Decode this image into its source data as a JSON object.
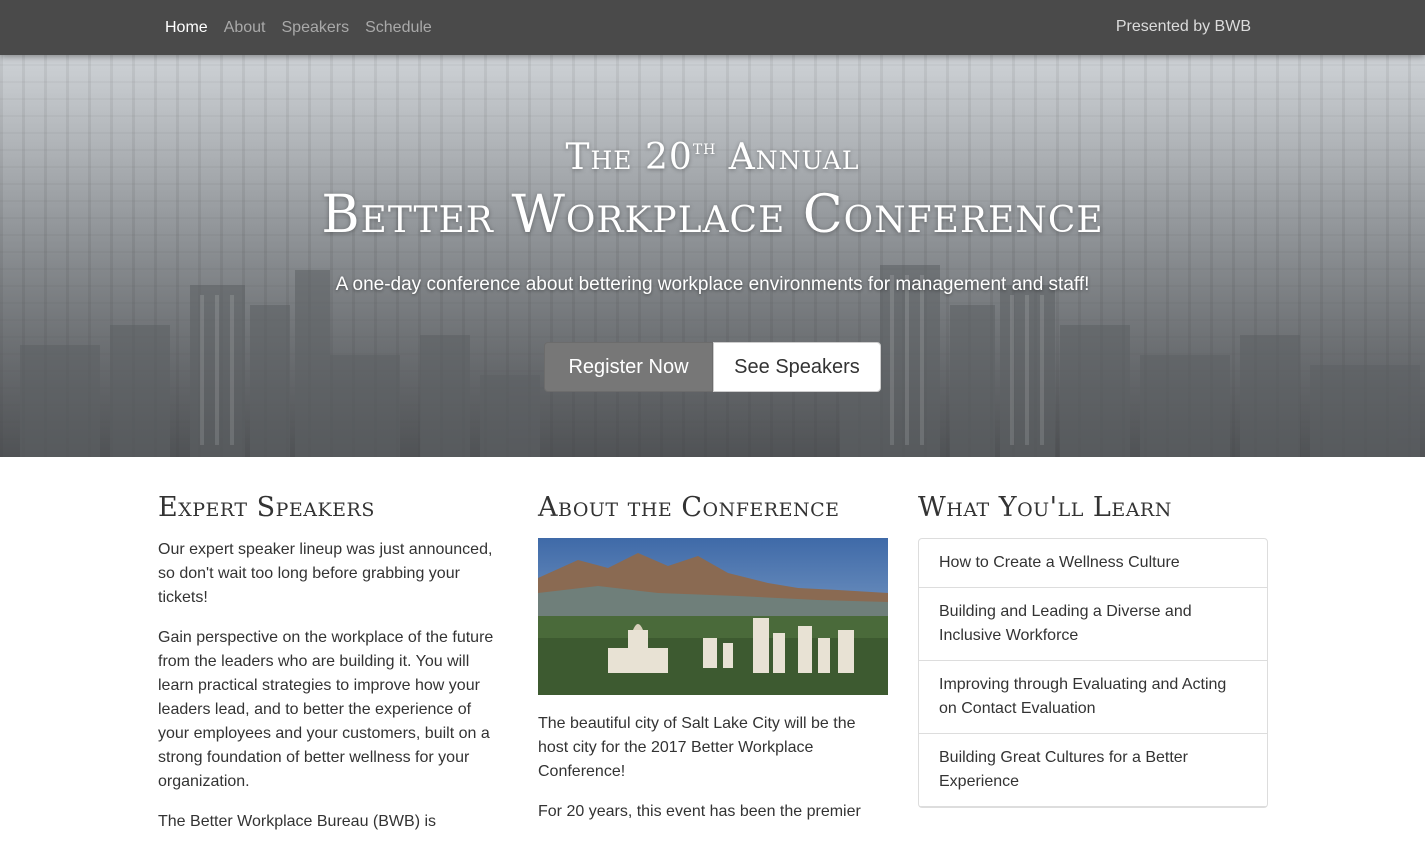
{
  "nav": {
    "items": [
      {
        "label": "Home",
        "active": true
      },
      {
        "label": "About",
        "active": false
      },
      {
        "label": "Speakers",
        "active": false
      },
      {
        "label": "Schedule",
        "active": false
      }
    ],
    "presented_by": "Presented by BWB"
  },
  "hero": {
    "pre_prefix": "The 20",
    "pre_sup": "th",
    "pre_suffix": " Annual",
    "title": "Better Workplace Conference",
    "subtitle": "A one-day conference about bettering workplace environments for management and staff!",
    "register_label": "Register Now",
    "speakers_label": "See Speakers"
  },
  "speakers_section": {
    "heading": "Expert Speakers",
    "paragraphs": [
      "Our expert speaker lineup was just announced, so don't wait too long before grabbing your tickets!",
      "Gain perspective on the workplace of the future from the leaders who are building it. You will learn practical strategies to improve how your leaders lead, and to better the experience of your employees and your customers, built on a strong foundation of better wellness for your organization.",
      "The Better Workplace Bureau (BWB) is"
    ]
  },
  "about_section": {
    "heading": "About the Conference",
    "paragraphs": [
      "The beautiful city of Salt Lake City will be the host city for the 2017 Better Workplace Conference!",
      "For 20 years, this event has been the premier"
    ]
  },
  "learn_section": {
    "heading": "What You'll Learn",
    "items": [
      "How to Create a Wellness Culture",
      "Building and Leading a Diverse and Inclusive Workforce",
      "Improving through Evaluating and Acting on Contact Evaluation",
      "Building Great Cultures for a Better Experience"
    ]
  },
  "colors": {
    "navbar": "#4a4a4a",
    "register_button": "#777777",
    "text": "#333333"
  }
}
